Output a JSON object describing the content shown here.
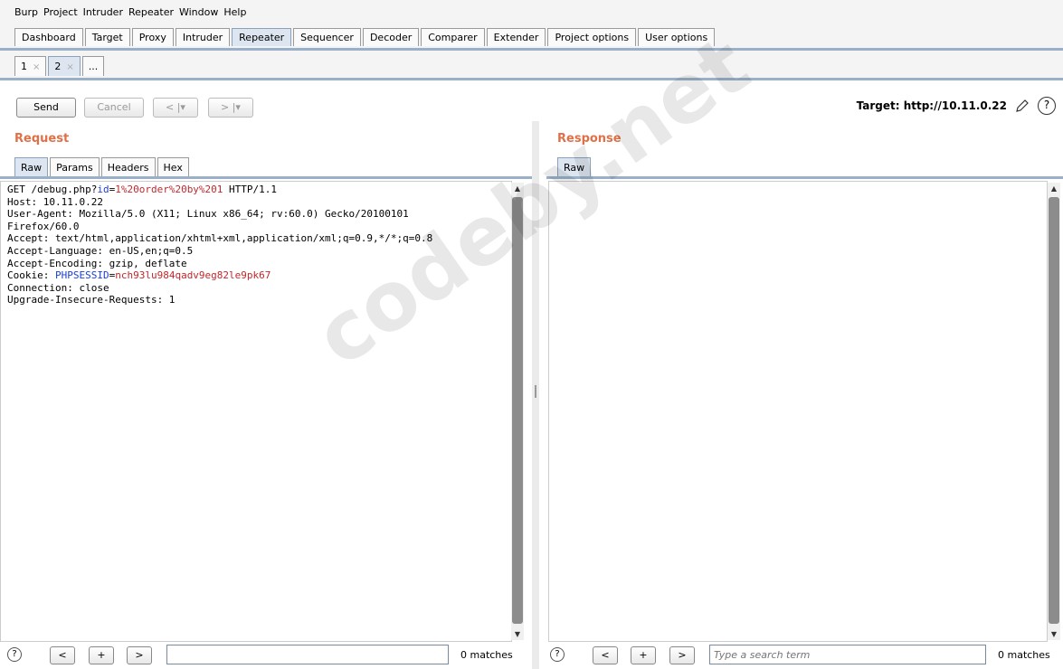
{
  "menu": [
    "Burp",
    "Project",
    "Intruder",
    "Repeater",
    "Window",
    "Help"
  ],
  "main_tabs": [
    "Dashboard",
    "Target",
    "Proxy",
    "Intruder",
    "Repeater",
    "Sequencer",
    "Decoder",
    "Comparer",
    "Extender",
    "Project options",
    "User options"
  ],
  "active_main_tab": "Repeater",
  "sub_tabs": [
    {
      "label": "1",
      "close": "×"
    },
    {
      "label": "2",
      "close": "×"
    }
  ],
  "sub_tab_more": "...",
  "toolbar": {
    "send": "Send",
    "cancel": "Cancel",
    "back": "< |▾",
    "forward": "> |▾",
    "target": "Target: http://10.11.0.22",
    "help": "?"
  },
  "request": {
    "title": "Request",
    "tabs": [
      "Raw",
      "Params",
      "Headers",
      "Hex"
    ],
    "lines": {
      "l1_pre": "GET /debug.php?",
      "l1_param": "id",
      "l1_eq": "=",
      "l1_value": "1%20order%20by%201",
      "l1_post": " HTTP/1.1",
      "l2": "Host: 10.11.0.22",
      "l3": "User-Agent: Mozilla/5.0 (X11; Linux x86_64; rv:60.0) Gecko/20100101",
      "l4": "Firefox/60.0",
      "l5": "Accept: text/html,application/xhtml+xml,application/xml;q=0.9,*/*;q=0.8",
      "l6": "Accept-Language: en-US,en;q=0.5",
      "l7": "Accept-Encoding: gzip, deflate",
      "l8_pre": "Cookie: ",
      "l8_param": "PHPSESSID",
      "l8_eq": "=",
      "l8_value": "nch93lu984qadv9eg82le9pk67",
      "l9": "Connection: close",
      "l10": "Upgrade-Insecure-Requests: 1"
    },
    "search": {
      "help": "?",
      "prev": "<",
      "add": "+",
      "next": ">",
      "value": "",
      "placeholder": "",
      "matches": "0 matches"
    }
  },
  "response": {
    "title": "Response",
    "tabs": [
      "Raw"
    ],
    "search": {
      "help": "?",
      "prev": "<",
      "add": "+",
      "next": ">",
      "value": "",
      "placeholder": "Type a search term",
      "matches": "0 matches"
    }
  },
  "watermark": "codeby.net",
  "colors": {
    "accent_title": "#e07047",
    "param": "#1d3fcf",
    "value": "#c0282d",
    "tab_active": "#dde6f0"
  }
}
